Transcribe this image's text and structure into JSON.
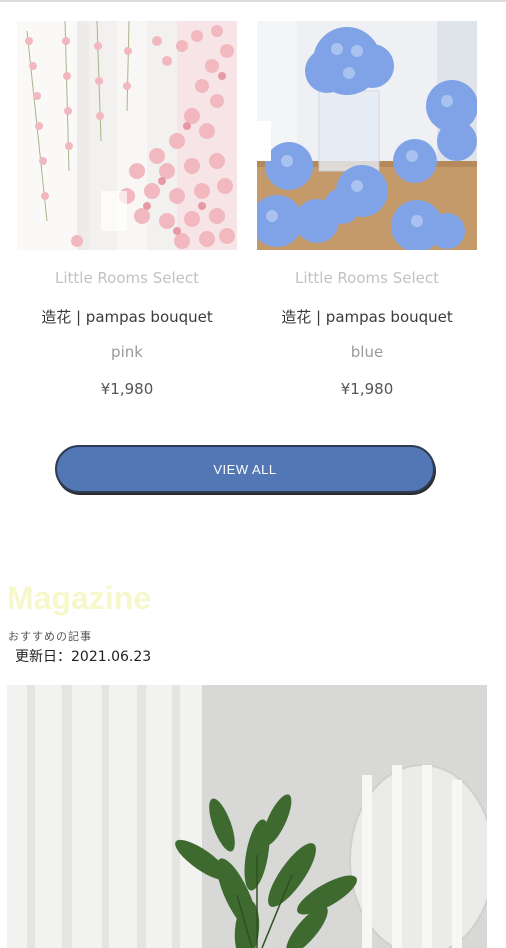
{
  "products": [
    {
      "brand": "Little Rooms Select",
      "name": "造花 | pampas bouquet",
      "variant": "pink",
      "price": "¥1,980",
      "image": "pink-cherry-blossom-garland-photo"
    },
    {
      "brand": "Little Rooms Select",
      "name": "造花 | pampas bouquet",
      "variant": "blue",
      "price": "¥1,980",
      "image": "blue-hydrangea-flowers-photo"
    }
  ],
  "view_all": {
    "label": "VIEW ALL"
  },
  "magazine": {
    "title": "Magazine",
    "subtitle": "おすすめの記事",
    "updated": "更新日：2021.06.23",
    "image": "plant-and-mirror-photo"
  },
  "colors": {
    "button": "#5277b4",
    "magazine_title": "#f6f8cc"
  }
}
